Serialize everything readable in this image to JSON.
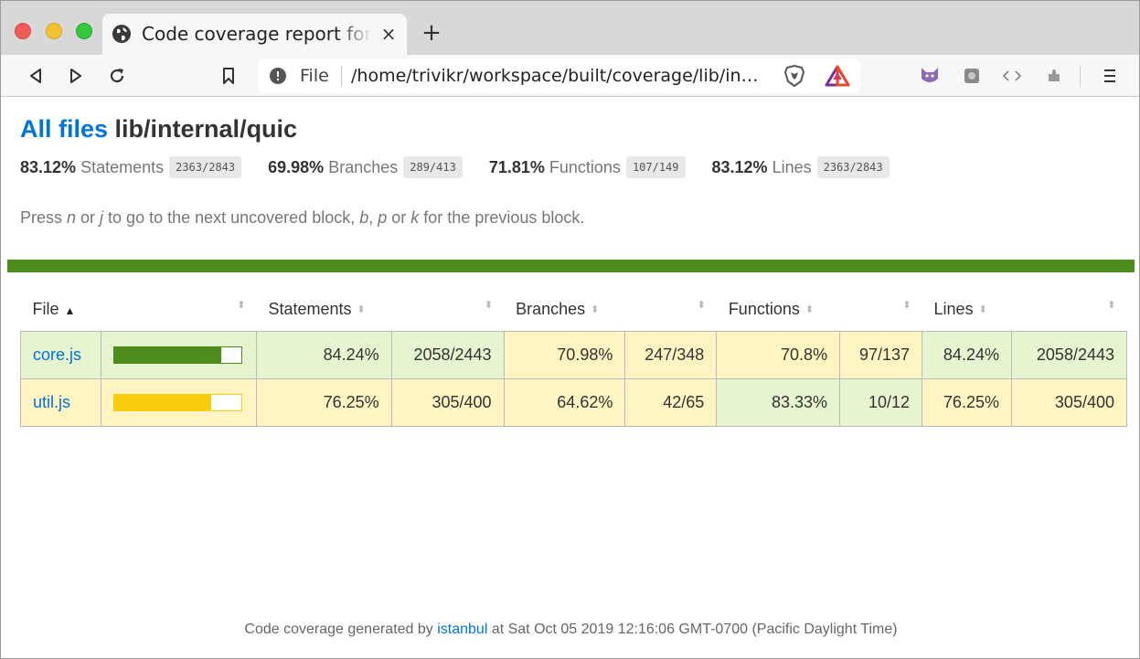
{
  "browser": {
    "tab_title": "Code coverage report for lib/internal/quic",
    "tab_close": "×",
    "new_tab": "+",
    "address_scheme": "File",
    "address_url": "/home/trivikr/workspace/built/coverage/lib/internal/quic/index.html"
  },
  "report": {
    "breadcrumb_link": "All files",
    "path": "lib/internal/quic",
    "summary": [
      {
        "pct": "83.12%",
        "label": "Statements",
        "fraction": "2363/2843"
      },
      {
        "pct": "69.98%",
        "label": "Branches",
        "fraction": "289/413"
      },
      {
        "pct": "71.81%",
        "label": "Functions",
        "fraction": "107/149"
      },
      {
        "pct": "83.12%",
        "label": "Lines",
        "fraction": "2363/2843"
      }
    ],
    "hint": {
      "t1": "Press ",
      "k1": "n",
      "t2": " or ",
      "k2": "j",
      "t3": " to go to the next uncovered block, ",
      "k3": "b",
      "t4": ", ",
      "k4": "p",
      "t5": " or ",
      "k5": "k",
      "t6": " for the previous block."
    },
    "colors": {
      "high": "#4d8d1c",
      "medium": "#f9cd0b",
      "high_bg": "#e6f5d0",
      "medium_bg": "#fff4c2"
    }
  },
  "table": {
    "headers": {
      "file": "File",
      "statements": "Statements",
      "branches": "Branches",
      "functions": "Functions",
      "lines": "Lines"
    },
    "sort_icons": {
      "asc": "▲",
      "both": "⬍"
    },
    "rows": [
      {
        "file": "core.js",
        "coverage_fraction": 0.8424,
        "level": "high",
        "statements_pct": "84.24%",
        "statements_frac": "2058/2443",
        "branches_pct": "70.98%",
        "branches_frac": "247/348",
        "functions_pct": "70.8%",
        "functions_frac": "97/137",
        "lines_pct": "84.24%",
        "lines_frac": "2058/2443"
      },
      {
        "file": "util.js",
        "coverage_fraction": 0.7625,
        "level": "medium",
        "statements_pct": "76.25%",
        "statements_frac": "305/400",
        "branches_pct": "64.62%",
        "branches_frac": "42/65",
        "functions_pct": "83.33%",
        "functions_frac": "10/12",
        "lines_pct": "76.25%",
        "lines_frac": "305/400"
      }
    ]
  },
  "footer": {
    "prefix": "Code coverage generated by ",
    "link": "istanbul",
    "suffix": " at Sat Oct 05 2019 12:16:06 GMT-0700 (Pacific Daylight Time)"
  }
}
